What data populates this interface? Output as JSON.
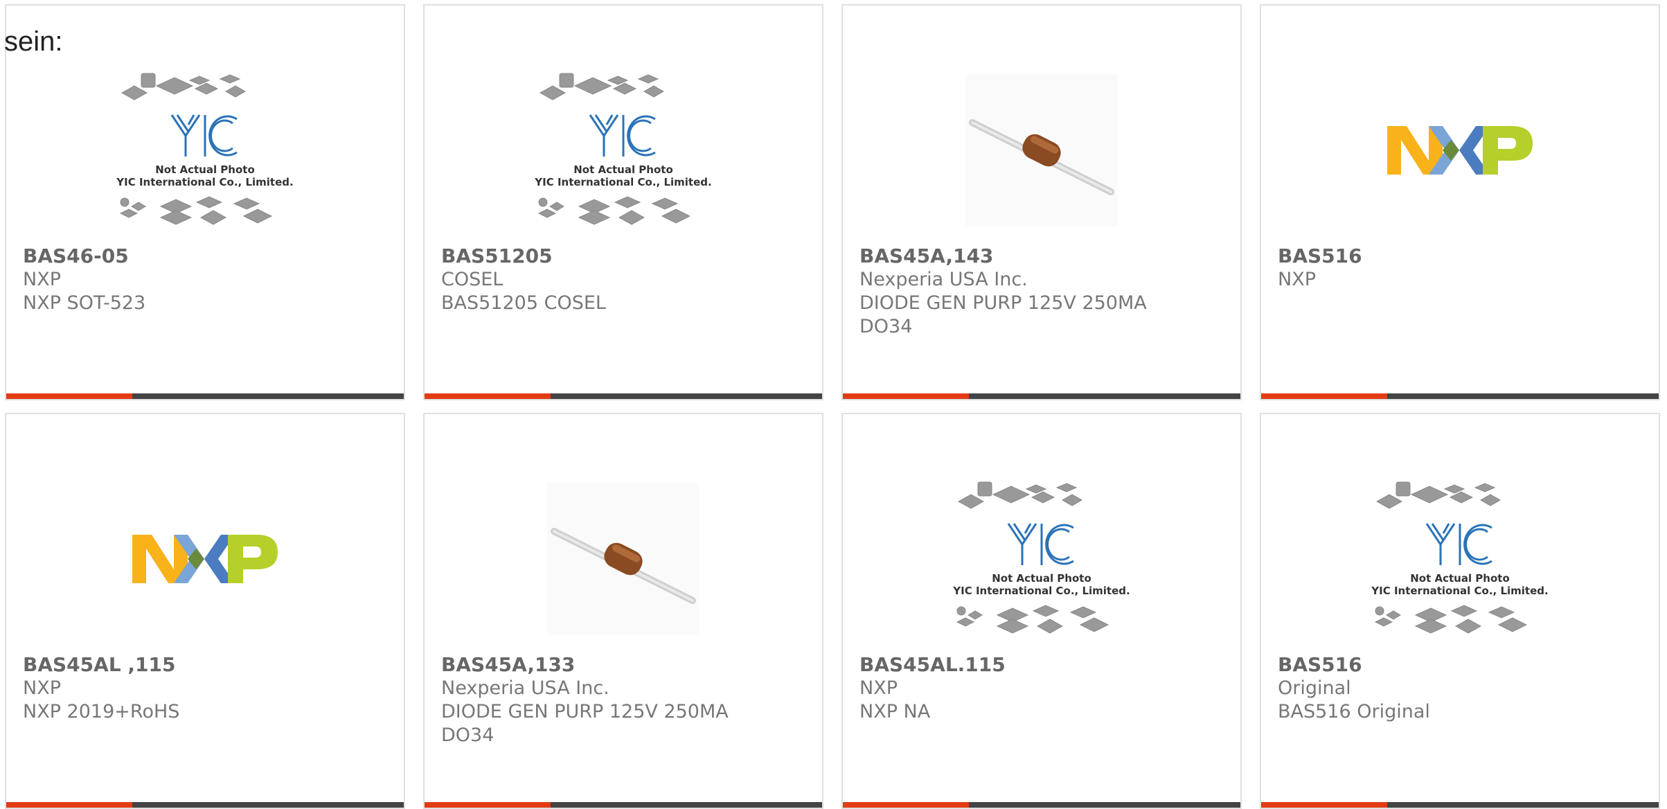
{
  "intro_text": "sein:",
  "colors": {
    "accent": "#e23c14",
    "bar": "#444444"
  },
  "placeholder": {
    "line1": "Not Actual Photo",
    "line2": "YIC International Co., Limited."
  },
  "products": [
    {
      "part": "BAS46-05",
      "lines": [
        "NXP",
        "NXP SOT-523"
      ],
      "image": "yic-placeholder"
    },
    {
      "part": "BAS51205",
      "lines": [
        "COSEL",
        "BAS51205 COSEL"
      ],
      "image": "yic-placeholder"
    },
    {
      "part": "BAS45A,143",
      "lines": [
        "Nexperia USA Inc.",
        "DIODE GEN PURP 125V 250MA",
        "DO34"
      ],
      "image": "diode"
    },
    {
      "part": "BAS516",
      "lines": [
        "NXP"
      ],
      "image": "nxp-logo"
    },
    {
      "part": "BAS45AL ,115",
      "lines": [
        "NXP",
        "NXP 2019+RoHS"
      ],
      "image": "nxp-logo"
    },
    {
      "part": "BAS45A,133",
      "lines": [
        "Nexperia USA Inc.",
        "DIODE GEN PURP 125V 250MA",
        "DO34"
      ],
      "image": "diode"
    },
    {
      "part": "BAS45AL.115",
      "lines": [
        "NXP",
        "NXP NA"
      ],
      "image": "yic-placeholder"
    },
    {
      "part": "BAS516",
      "lines": [
        "Original",
        "BAS516 Original"
      ],
      "image": "yic-placeholder"
    }
  ]
}
